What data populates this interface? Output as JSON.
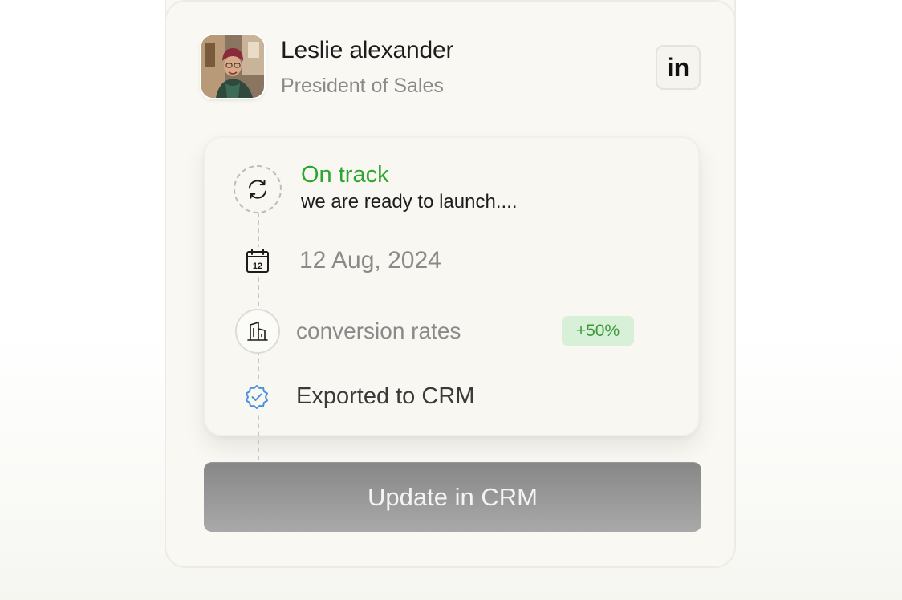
{
  "profile": {
    "name": "Leslie alexander",
    "role": "President of Sales",
    "linkedin_label": "in"
  },
  "timeline": {
    "status_title": "On track",
    "status_description": "we are ready to launch....",
    "date": "12 Aug, 2024",
    "calendar_day": "12",
    "metric_label": "conversion rates",
    "metric_change": "+50%",
    "export_status": "Exported to CRM"
  },
  "actions": {
    "update_label": "Update in CRM"
  },
  "icons": {
    "status": "sync-icon",
    "date": "calendar-icon",
    "metric": "building-icon",
    "export": "verified-badge-icon",
    "social": "linkedin-icon"
  },
  "colors": {
    "status_green": "#2fa52f",
    "badge_background": "#d8efd8",
    "verified_blue": "#4a8ee0",
    "button_gray": "#999999"
  }
}
